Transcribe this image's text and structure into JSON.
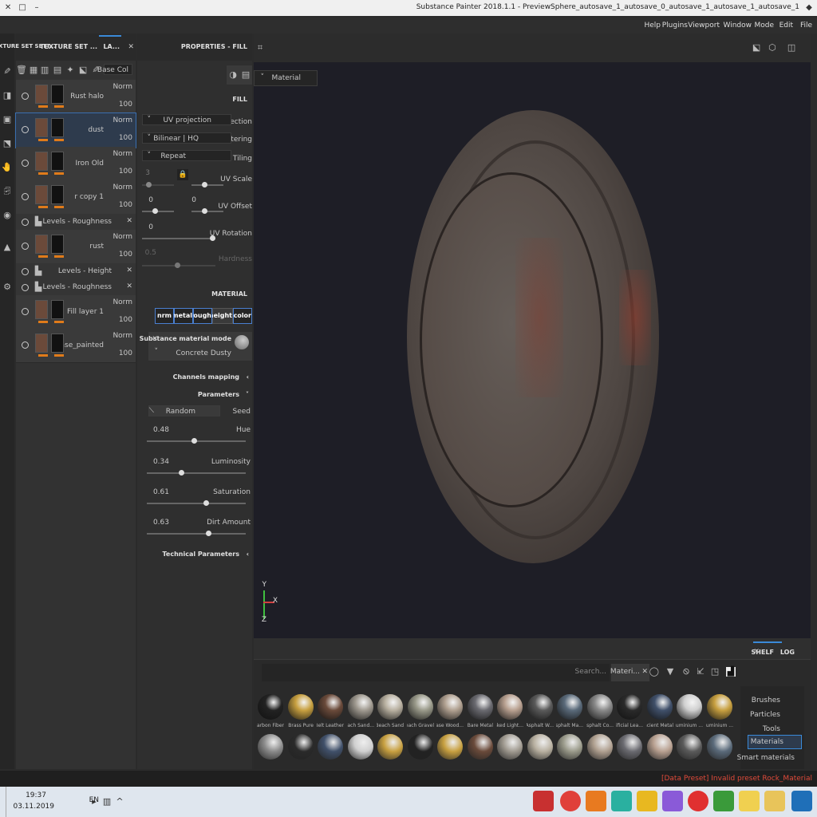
{
  "window": {
    "title": "Substance Painter 2018.1.1 - PreviewSphere_autosave_1_autosave_0_autosave_1_autosave_1_autosave_1"
  },
  "menu": [
    "File",
    "Edit",
    "Mode",
    "Window",
    "Viewport",
    "Plugins",
    "Help"
  ],
  "viewport": {
    "display_mode": "Material",
    "axis_labels": {
      "x": "X",
      "y": "Y",
      "z": "Z"
    }
  },
  "properties": {
    "header": "PROPERTIES - FILL",
    "fill_section": "FILL",
    "projection_label": "Projection",
    "projection_value": "UV projection",
    "filtering_label": "Filtering",
    "filtering_value": "Bilinear | HQ",
    "tiling_label": "Tiling",
    "tiling_value": "Repeat",
    "uv_scale_label": "UV Scale",
    "uv_scale_a": "3",
    "uv_scale_b": "3",
    "uv_offset_label": "UV Offset",
    "uv_offset_a": "0",
    "uv_offset_b": "0",
    "uv_rotation_label": "UV Rotation",
    "uv_rotation_value": "0",
    "hardness_label": "Hardness",
    "hardness_value": "0.5",
    "material_section": "MATERIAL",
    "channels": [
      "color",
      "height",
      "rough",
      "metal",
      "nrm"
    ],
    "material_mode_label": "Substance material mode",
    "material_name": "Concrete Dusty",
    "channels_mapping": "Channels mapping",
    "parameters": "Parameters",
    "seed_label": "Seed",
    "seed_value": "Random",
    "hue_label": "Hue",
    "hue_value": "0.48",
    "hue_level": 0.48,
    "luminosity_label": "Luminosity",
    "luminosity_value": "0.34",
    "luminosity_level": 0.34,
    "saturation_label": "Saturation",
    "saturation_value": "0.61",
    "saturation_level": 0.61,
    "dirt_label": "Dirt Amount",
    "dirt_value": "0.63",
    "dirt_level": 0.63,
    "technical_parameters": "Technical Parameters"
  },
  "layers_panel": {
    "tabs": [
      "TEXTURE SET SETT...",
      "TEXTURE SET ...",
      "LA..."
    ],
    "channel_select": "Base Col",
    "layers": [
      {
        "name": "Rust halo",
        "blend": "Norm",
        "opacity": "100"
      },
      {
        "name": "dust",
        "blend": "Norm",
        "opacity": "100"
      },
      {
        "name": "Iron Old",
        "blend": "Norm",
        "opacity": "100"
      },
      {
        "name": "r copy 1",
        "blend": "Norm",
        "opacity": "100"
      },
      {
        "name": "Levels - Roughness",
        "sub": true
      },
      {
        "name": "rust",
        "blend": "Norm",
        "opacity": "100"
      },
      {
        "name": "Levels - Height",
        "sub": true
      },
      {
        "name": "Levels - Roughness",
        "sub": true
      },
      {
        "name": "Fill layer 1",
        "blend": "Norm",
        "opacity": "100"
      },
      {
        "name": "base_painted",
        "blend": "Norm",
        "opacity": "100"
      }
    ]
  },
  "shelf": {
    "tabs": [
      "SHELF",
      "LOG"
    ],
    "filter_tag": "Materi...",
    "search_placeholder": "Search...",
    "categories": [
      "Brushes",
      "Particles",
      "Tools",
      "Materials",
      "Smart materials"
    ],
    "materials_row1": [
      "Aluminium ...",
      "Aluminium ...",
      "Ancient Metal",
      "Artificial Lea...",
      "Asphalt Co...",
      "Asphalt Ma...",
      "Asphalt W...",
      "Baked Light...",
      "Bare Metal",
      "Base Wood...",
      "Beach Gravel",
      "Beach Sand",
      "Beach Sand...",
      "Belt Leather",
      "Brass Pure",
      "Carbon Fiber"
    ]
  },
  "status": {
    "message": "[Data Preset] Invalid preset Rock_Material"
  },
  "taskbar": {
    "language": "EN",
    "time": "19:37",
    "date": "03.11.2019"
  }
}
